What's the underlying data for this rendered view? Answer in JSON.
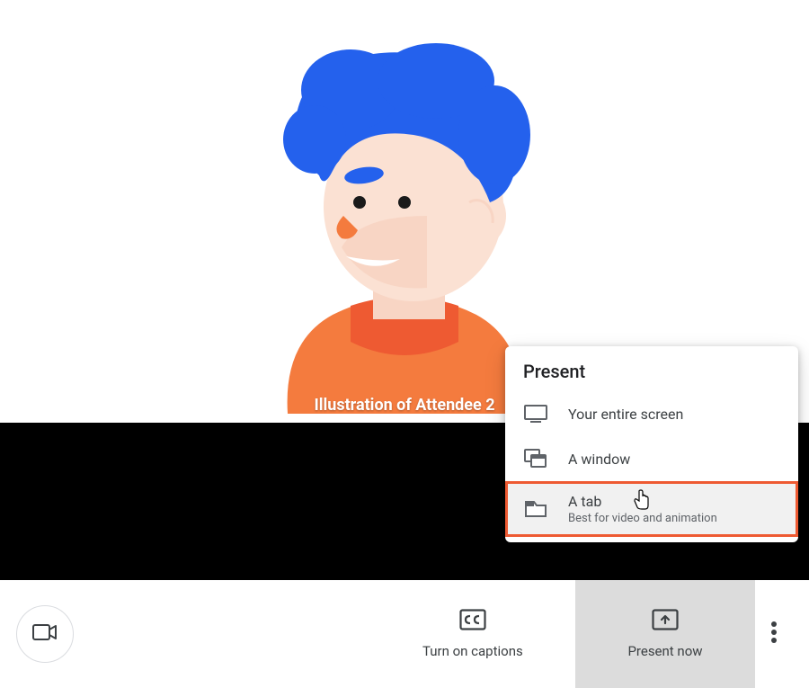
{
  "avatar": {
    "caption": "Illustration of Attendee 2"
  },
  "present_menu": {
    "title": "Present",
    "items": [
      {
        "label": "Your entire screen",
        "subtitle": ""
      },
      {
        "label": "A window",
        "subtitle": ""
      },
      {
        "label": "A tab",
        "subtitle": "Best for video and animation"
      }
    ]
  },
  "toolbar": {
    "captions_label": "Turn on captions",
    "present_label": "Present now"
  }
}
